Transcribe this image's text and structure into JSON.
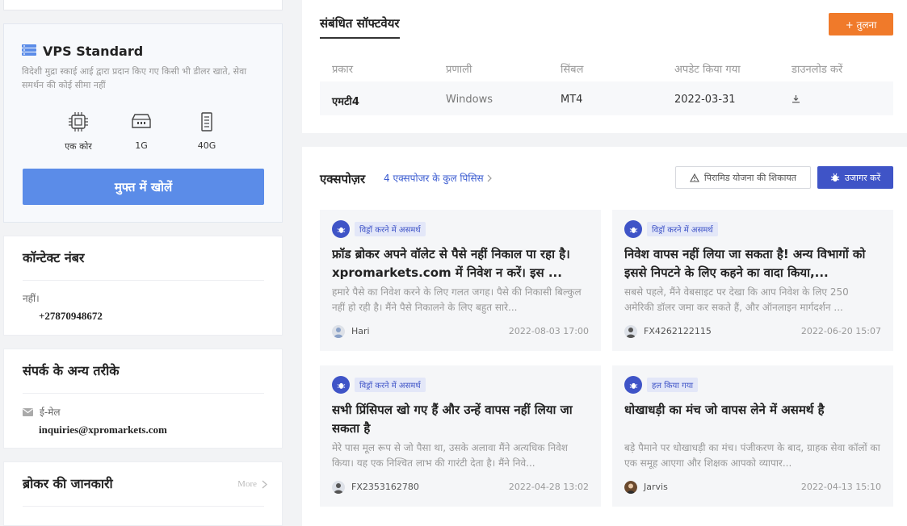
{
  "vps": {
    "title": "VPS Standard",
    "description": "विदेशी मुद्रा स्काई आई द्वारा प्रदान किए गए किसी भी डीलर खाते, सेवा समर्थन की कोई सीमा नहीं",
    "specs": [
      {
        "icon": "cpu-icon",
        "label": "एक कोर"
      },
      {
        "icon": "memory-icon",
        "label": "1G"
      },
      {
        "icon": "storage-icon",
        "label": "40G"
      }
    ],
    "button": "मुफ्त में खोलें"
  },
  "contact": {
    "title": "कॉन्टेक्ट नंबर",
    "label": "नहीं।",
    "phone": "+27870948672"
  },
  "other_contact": {
    "title": "संपर्क के अन्य तरीके",
    "email_label": "ई-मेल",
    "email": "inquiries@xpromarkets.com"
  },
  "broker_info": {
    "title": "ब्रोकर की जानकारी",
    "more": "More"
  },
  "software": {
    "title": "संबंधित सॉफ्टवेयर",
    "compare_button": "+ तुलना",
    "columns": [
      "प्रकार",
      "प्रणाली",
      "सिंबल",
      "अपडेट किया गया",
      "डाउनलोड करें"
    ],
    "row": {
      "type": "एमटी4",
      "system": "Windows",
      "symbol": "MT4",
      "updated": "2022-03-31"
    }
  },
  "exposure": {
    "title": "एक्सपोज़र",
    "count_link": "4 एक्सपोजर के कुल पिसिस",
    "complain_button": "पिरामिड योजना की शिकायत",
    "reveal_button": "उजागर करें",
    "posts": [
      {
        "tag": "विड्रॉ करने में असमर्थ",
        "title": "फ्रॉड ब्रोकर अपने वॉलेट से पैसे नहीं निकाल पा रहा है। xpromarkets.com में निवेश न करें। इस ...",
        "body": "हमारे पैसे का निवेश करने के लिए गलत जगह। पैसे की निकासी बिल्कुल नहीं हो रही है। मैंने पैसे निकालने के लिए बहुत सारे...",
        "user": "Hari",
        "time": "2022-08-03 17:00"
      },
      {
        "tag": "विड्रॉ करने में असमर्थ",
        "title": "निवेश वापस नहीं लिया जा सकता है! अन्य विभागों को इससे निपटने के लिए कहने का वादा किया,...",
        "body": "सबसे पहले, मैंने वेबसाइट पर देखा कि आप निवेश के लिए 250 अमेरिकी डॉलर जमा कर सकते हैं, और ऑनलाइन मार्गदर्शन ...",
        "user": "FX4262122115",
        "time": "2022-06-20 15:07"
      },
      {
        "tag": "विड्रॉ करने में असमर्थ",
        "title": "सभी प्रिंसिपल खो गए हैं और उन्हें वापस नहीं लिया जा सकता है",
        "body": "मेरे पास मूल रूप से जो पैसा था, उसके अलावा मैंने अत्यधिक निवेश किया। यह एक निश्चित लाभ की गारंटी देता है। मैंने निवे...",
        "user": "FX2353162780",
        "time": "2022-04-28 13:02"
      },
      {
        "tag": "हल किया गया",
        "title": "धोखाधड़ी का मंच जो वापस लेने में असमर्थ है",
        "body": "बड़े पैमाने पर धोखाधड़ी का मंच। पंजीकरण के बाद, ग्राहक सेवा कॉलों का एक समूह आएगा और शिक्षक आपको व्यापार...",
        "user": "Jarvis",
        "time": "2022-04-13 15:10"
      }
    ]
  },
  "colors": {
    "accent_blue": "#3f54c7",
    "open_button": "#5b8ce8",
    "compare_orange": "#f07a2a"
  }
}
